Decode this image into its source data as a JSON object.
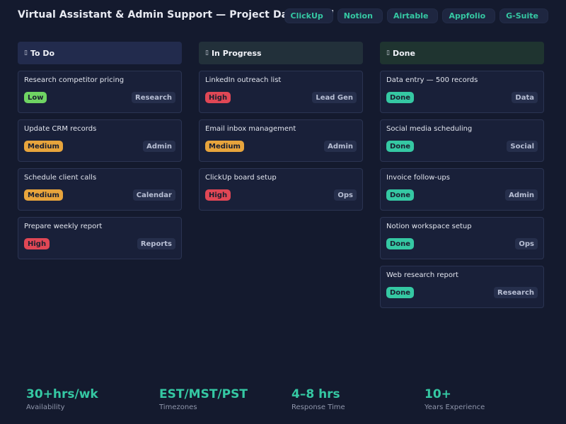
{
  "header": {
    "title": "Virtual Assistant & Admin Support  —  Project Dashboard",
    "tools": [
      "ClickUp",
      "Notion",
      "Airtable",
      "Appfolio",
      "G-Suite"
    ]
  },
  "columns": [
    {
      "label": "To Do",
      "icon": "square-icon",
      "head_color": "#222b4d",
      "cards": [
        {
          "title": "Research competitor pricing",
          "priority": "Low",
          "tag": "Research"
        },
        {
          "title": "Update CRM records",
          "priority": "Medium",
          "tag": "Admin"
        },
        {
          "title": "Schedule client calls",
          "priority": "Medium",
          "tag": "Calendar"
        },
        {
          "title": "Prepare weekly report",
          "priority": "High",
          "tag": "Reports"
        }
      ]
    },
    {
      "label": "In Progress",
      "icon": "square-icon",
      "head_color": "#22303a",
      "cards": [
        {
          "title": "LinkedIn outreach list",
          "priority": "High",
          "tag": "Lead Gen"
        },
        {
          "title": "Email inbox management",
          "priority": "Medium",
          "tag": "Admin"
        },
        {
          "title": "ClickUp board setup",
          "priority": "High",
          "tag": "Ops"
        }
      ]
    },
    {
      "label": "Done",
      "icon": "square-icon",
      "head_color": "#1f3430",
      "cards": [
        {
          "title": "Data entry — 500 records",
          "priority": "Done",
          "tag": "Data"
        },
        {
          "title": "Social media scheduling",
          "priority": "Done",
          "tag": "Social"
        },
        {
          "title": "Invoice follow-ups",
          "priority": "Done",
          "tag": "Admin"
        },
        {
          "title": "Notion workspace setup",
          "priority": "Done",
          "tag": "Ops"
        },
        {
          "title": "Web research report",
          "priority": "Done",
          "tag": "Research"
        }
      ]
    }
  ],
  "priority_colors": {
    "Low": "#6fd463",
    "Medium": "#e7a43c",
    "High": "#e04755",
    "Done": "#35c8a3"
  },
  "stats": [
    {
      "value": "30+hrs/wk",
      "label": "Availability"
    },
    {
      "value": "EST/MST/PST",
      "label": "Timezones"
    },
    {
      "value": "4–8 hrs",
      "label": "Response Time"
    },
    {
      "value": "10+",
      "label": "Years Experience"
    }
  ]
}
